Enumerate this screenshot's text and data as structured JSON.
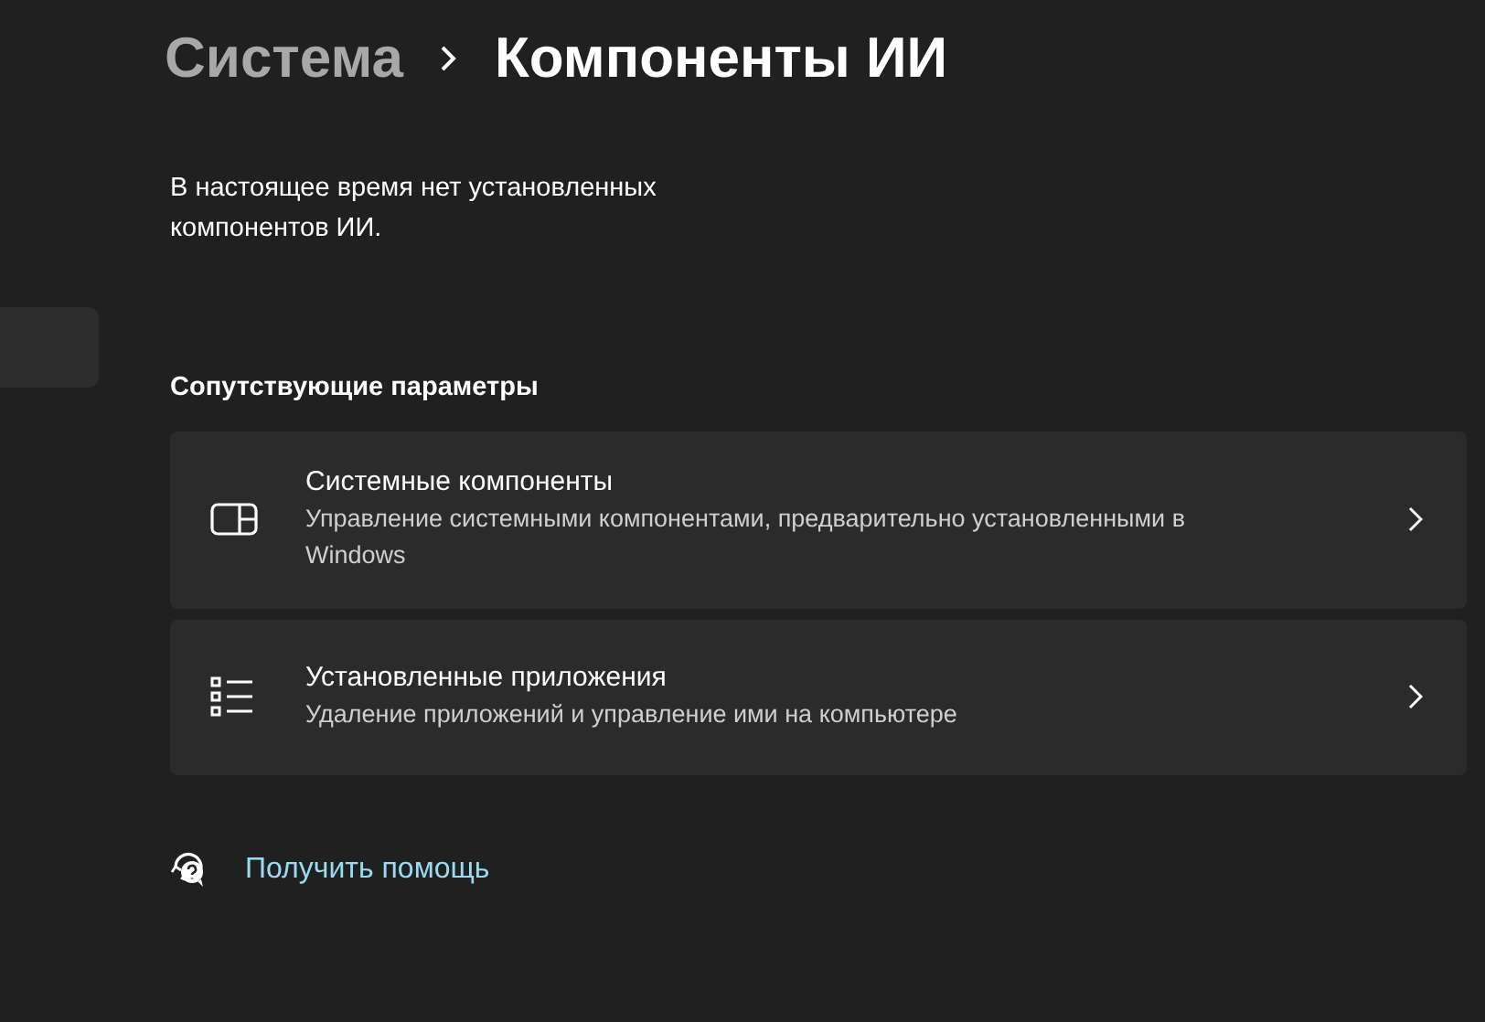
{
  "breadcrumb": [
    "Система",
    "Компоненты ИИ"
  ],
  "message": "В настоящее время нет установленных компонентов ИИ.",
  "related_settings": {
    "heading": "Сопутствующие параметры",
    "items": [
      {
        "kind": "components",
        "title": "Системные компоненты",
        "description": "Управление системными компонентами, предварительно установленными в Windows"
      },
      {
        "kind": "apps",
        "title": "Установленные приложения",
        "description": "Удаление приложений и управление ими на компьютере"
      }
    ]
  },
  "help_link": "Получить помощь"
}
